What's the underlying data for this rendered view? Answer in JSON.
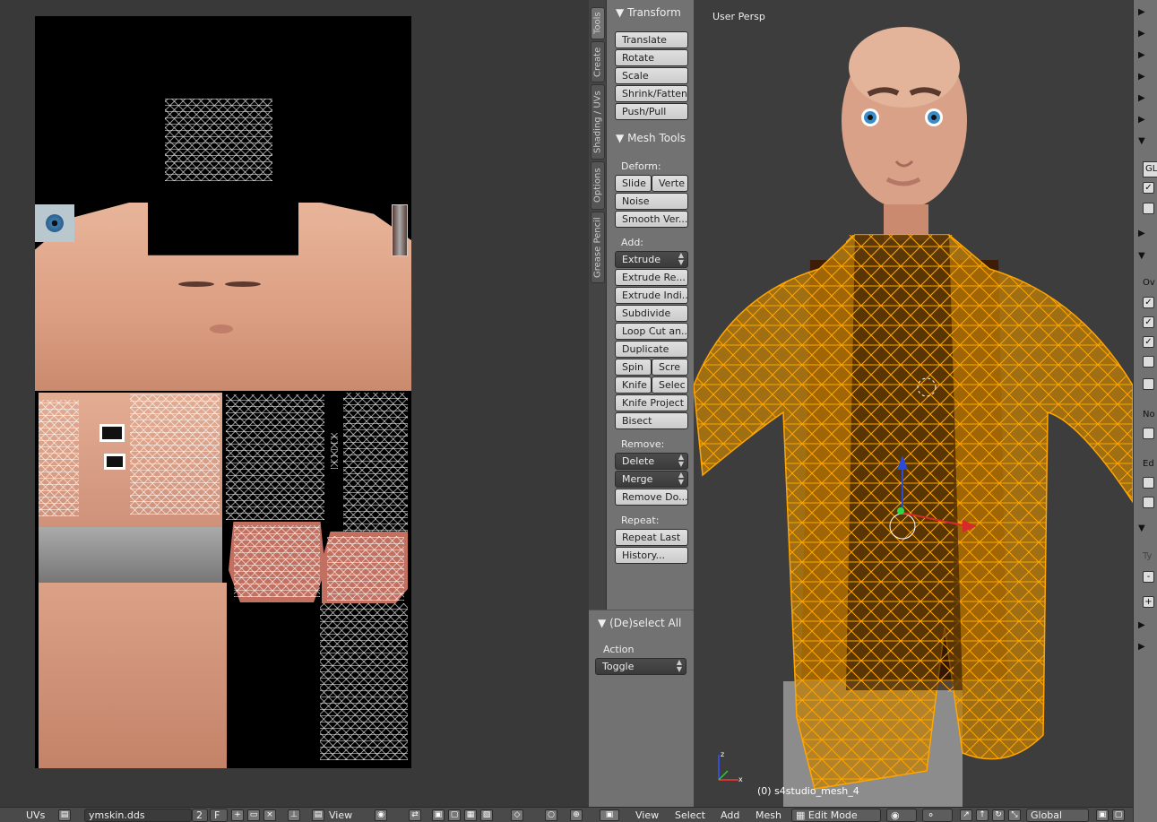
{
  "toolshelf": {
    "tabs": [
      "Tools",
      "Create",
      "Shading / UVs",
      "Options",
      "Grease Pencil"
    ],
    "transform": {
      "title": "Transform",
      "buttons": [
        "Translate",
        "Rotate",
        "Scale",
        "Shrink/Fatten",
        "Push/Pull"
      ]
    },
    "mesh_tools": {
      "title": "Mesh Tools",
      "deform_label": "Deform:",
      "deform": {
        "slide": "Slide",
        "vertex": "Verte",
        "noise": "Noise",
        "smooth": "Smooth Ver..."
      },
      "add_label": "Add:",
      "add": {
        "extrude": "Extrude",
        "extrude_region": "Extrude Re...",
        "extrude_individual": "Extrude Indi...",
        "subdivide": "Subdivide",
        "loop_cut": "Loop Cut an...",
        "duplicate": "Duplicate",
        "spin": "Spin",
        "screw": "Scre",
        "knife": "Knife",
        "select": "Selec",
        "knife_project": "Knife Project",
        "bisect": "Bisect"
      },
      "remove_label": "Remove:",
      "remove": {
        "delete": "Delete",
        "merge": "Merge",
        "remove_doubles": "Remove Do..."
      },
      "repeat_label": "Repeat:",
      "repeat": {
        "repeat_last": "Repeat Last",
        "history": "History..."
      }
    }
  },
  "redo_panel": {
    "title": "(De)select All",
    "action_label": "Action",
    "action_value": "Toggle"
  },
  "viewport": {
    "view_name": "User Persp",
    "object_name": "(0) s4studio_mesh_4",
    "mesh_color": "#ffa500"
  },
  "properties": {
    "labels": [
      "GL",
      "Ov",
      "No",
      "Ed",
      "Ty"
    ]
  },
  "uv_header": {
    "uvs": "UVs",
    "image_name": "ymskin.dds",
    "users": "2",
    "fake": "F",
    "view": "View"
  },
  "vp_header": {
    "view": "View",
    "select": "Select",
    "add": "Add",
    "mesh": "Mesh",
    "mode": "Edit Mode",
    "orientation": "Global"
  }
}
